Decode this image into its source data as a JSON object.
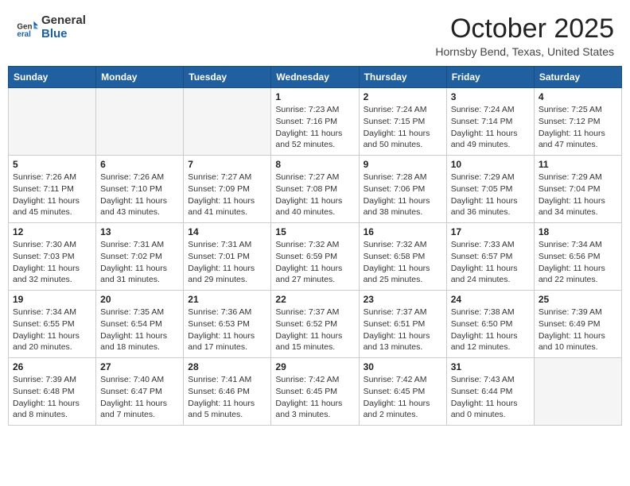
{
  "header": {
    "logo_general": "General",
    "logo_blue": "Blue",
    "month_title": "October 2025",
    "location": "Hornsby Bend, Texas, United States"
  },
  "weekdays": [
    "Sunday",
    "Monday",
    "Tuesday",
    "Wednesday",
    "Thursday",
    "Friday",
    "Saturday"
  ],
  "weeks": [
    [
      {
        "day": "",
        "info": ""
      },
      {
        "day": "",
        "info": ""
      },
      {
        "day": "",
        "info": ""
      },
      {
        "day": "1",
        "info": "Sunrise: 7:23 AM\nSunset: 7:16 PM\nDaylight: 11 hours\nand 52 minutes."
      },
      {
        "day": "2",
        "info": "Sunrise: 7:24 AM\nSunset: 7:15 PM\nDaylight: 11 hours\nand 50 minutes."
      },
      {
        "day": "3",
        "info": "Sunrise: 7:24 AM\nSunset: 7:14 PM\nDaylight: 11 hours\nand 49 minutes."
      },
      {
        "day": "4",
        "info": "Sunrise: 7:25 AM\nSunset: 7:12 PM\nDaylight: 11 hours\nand 47 minutes."
      }
    ],
    [
      {
        "day": "5",
        "info": "Sunrise: 7:26 AM\nSunset: 7:11 PM\nDaylight: 11 hours\nand 45 minutes."
      },
      {
        "day": "6",
        "info": "Sunrise: 7:26 AM\nSunset: 7:10 PM\nDaylight: 11 hours\nand 43 minutes."
      },
      {
        "day": "7",
        "info": "Sunrise: 7:27 AM\nSunset: 7:09 PM\nDaylight: 11 hours\nand 41 minutes."
      },
      {
        "day": "8",
        "info": "Sunrise: 7:27 AM\nSunset: 7:08 PM\nDaylight: 11 hours\nand 40 minutes."
      },
      {
        "day": "9",
        "info": "Sunrise: 7:28 AM\nSunset: 7:06 PM\nDaylight: 11 hours\nand 38 minutes."
      },
      {
        "day": "10",
        "info": "Sunrise: 7:29 AM\nSunset: 7:05 PM\nDaylight: 11 hours\nand 36 minutes."
      },
      {
        "day": "11",
        "info": "Sunrise: 7:29 AM\nSunset: 7:04 PM\nDaylight: 11 hours\nand 34 minutes."
      }
    ],
    [
      {
        "day": "12",
        "info": "Sunrise: 7:30 AM\nSunset: 7:03 PM\nDaylight: 11 hours\nand 32 minutes."
      },
      {
        "day": "13",
        "info": "Sunrise: 7:31 AM\nSunset: 7:02 PM\nDaylight: 11 hours\nand 31 minutes."
      },
      {
        "day": "14",
        "info": "Sunrise: 7:31 AM\nSunset: 7:01 PM\nDaylight: 11 hours\nand 29 minutes."
      },
      {
        "day": "15",
        "info": "Sunrise: 7:32 AM\nSunset: 6:59 PM\nDaylight: 11 hours\nand 27 minutes."
      },
      {
        "day": "16",
        "info": "Sunrise: 7:32 AM\nSunset: 6:58 PM\nDaylight: 11 hours\nand 25 minutes."
      },
      {
        "day": "17",
        "info": "Sunrise: 7:33 AM\nSunset: 6:57 PM\nDaylight: 11 hours\nand 24 minutes."
      },
      {
        "day": "18",
        "info": "Sunrise: 7:34 AM\nSunset: 6:56 PM\nDaylight: 11 hours\nand 22 minutes."
      }
    ],
    [
      {
        "day": "19",
        "info": "Sunrise: 7:34 AM\nSunset: 6:55 PM\nDaylight: 11 hours\nand 20 minutes."
      },
      {
        "day": "20",
        "info": "Sunrise: 7:35 AM\nSunset: 6:54 PM\nDaylight: 11 hours\nand 18 minutes."
      },
      {
        "day": "21",
        "info": "Sunrise: 7:36 AM\nSunset: 6:53 PM\nDaylight: 11 hours\nand 17 minutes."
      },
      {
        "day": "22",
        "info": "Sunrise: 7:37 AM\nSunset: 6:52 PM\nDaylight: 11 hours\nand 15 minutes."
      },
      {
        "day": "23",
        "info": "Sunrise: 7:37 AM\nSunset: 6:51 PM\nDaylight: 11 hours\nand 13 minutes."
      },
      {
        "day": "24",
        "info": "Sunrise: 7:38 AM\nSunset: 6:50 PM\nDaylight: 11 hours\nand 12 minutes."
      },
      {
        "day": "25",
        "info": "Sunrise: 7:39 AM\nSunset: 6:49 PM\nDaylight: 11 hours\nand 10 minutes."
      }
    ],
    [
      {
        "day": "26",
        "info": "Sunrise: 7:39 AM\nSunset: 6:48 PM\nDaylight: 11 hours\nand 8 minutes."
      },
      {
        "day": "27",
        "info": "Sunrise: 7:40 AM\nSunset: 6:47 PM\nDaylight: 11 hours\nand 7 minutes."
      },
      {
        "day": "28",
        "info": "Sunrise: 7:41 AM\nSunset: 6:46 PM\nDaylight: 11 hours\nand 5 minutes."
      },
      {
        "day": "29",
        "info": "Sunrise: 7:42 AM\nSunset: 6:45 PM\nDaylight: 11 hours\nand 3 minutes."
      },
      {
        "day": "30",
        "info": "Sunrise: 7:42 AM\nSunset: 6:45 PM\nDaylight: 11 hours\nand 2 minutes."
      },
      {
        "day": "31",
        "info": "Sunrise: 7:43 AM\nSunset: 6:44 PM\nDaylight: 11 hours\nand 0 minutes."
      },
      {
        "day": "",
        "info": ""
      }
    ]
  ]
}
